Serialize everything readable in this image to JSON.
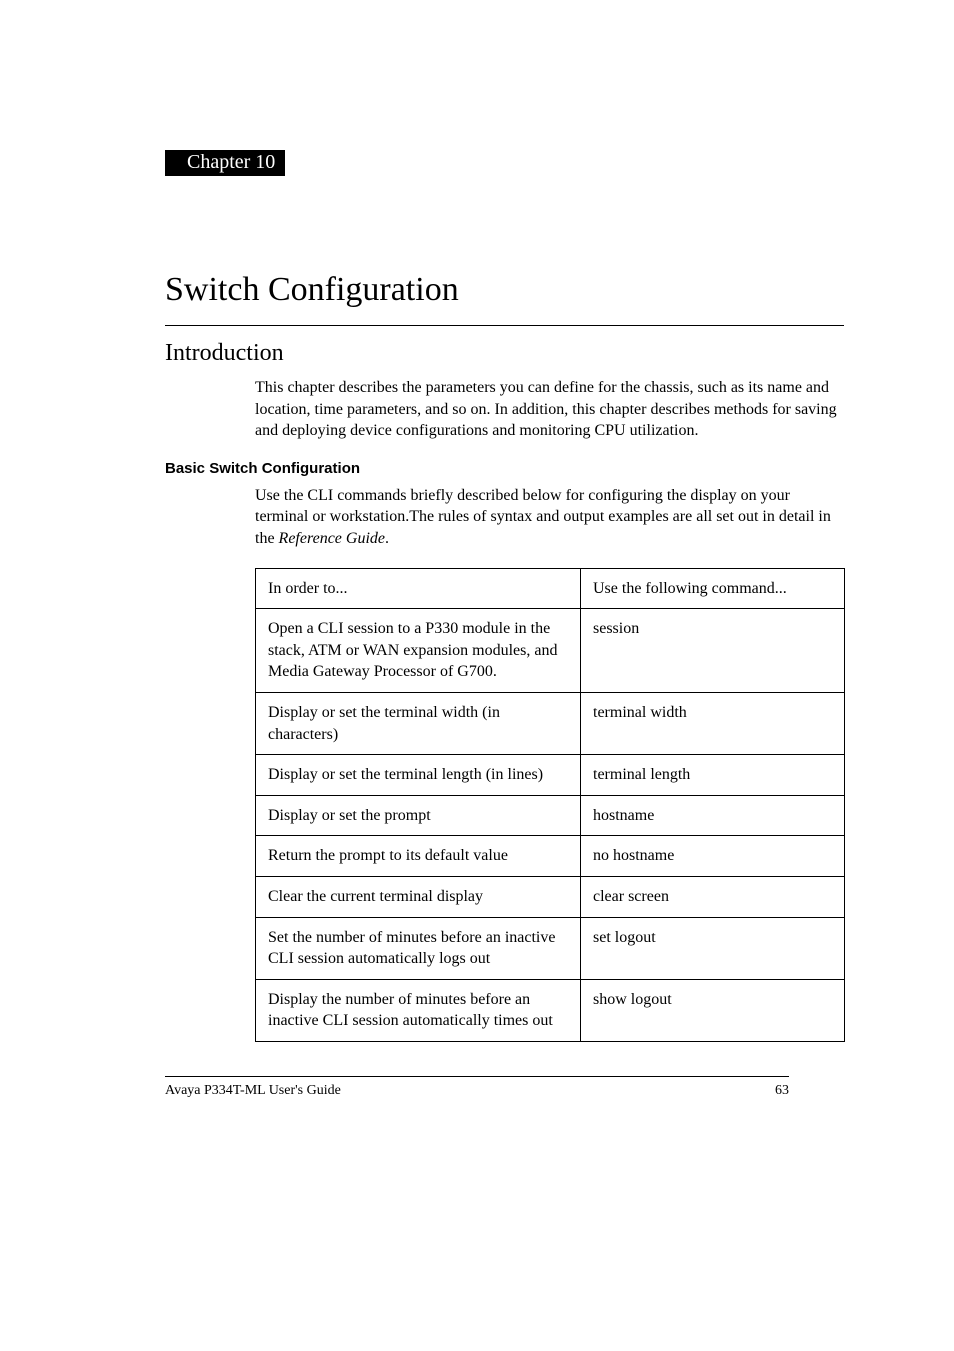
{
  "chapter": {
    "label": "Chapter 10"
  },
  "title": "Switch Configuration",
  "section": "Introduction",
  "intro_paragraph": "This chapter describes the parameters you can define for the chassis, such as its name and location, time parameters, and so on. In addition, this chapter describes methods for saving and deploying device configurations and monitoring CPU utilization.",
  "subhead": "Basic Switch Configuration",
  "sub_paragraph_pre": "Use the CLI commands briefly described below for configuring the display on your terminal or workstation.The rules of syntax and output examples are all set out in detail in the ",
  "sub_paragraph_em": "Reference Guide",
  "sub_paragraph_post": ".",
  "table": {
    "header": {
      "left": "In order to...",
      "right": "Use the following command..."
    },
    "rows": [
      {
        "left": "Open a CLI session to a P330 module in the stack, ATM or WAN expansion modules, and Media Gateway Processor of G700.",
        "right": "session"
      },
      {
        "left": "Display or set the terminal width (in characters)",
        "right": "terminal width"
      },
      {
        "left": "Display or set the terminal length (in lines)",
        "right": "terminal length"
      },
      {
        "left": "Display or set the prompt",
        "right": "hostname"
      },
      {
        "left": "Return the prompt to its default value",
        "right": "no hostname"
      },
      {
        "left": "Clear the current terminal display",
        "right": "clear screen"
      },
      {
        "left": "Set the number of minutes before an inactive CLI session automatically logs out",
        "right": "set logout"
      },
      {
        "left": "Display the number of minutes before an inactive CLI session automatically times out",
        "right": "show logout"
      }
    ]
  },
  "footer": {
    "left": "Avaya P334T-ML User's Guide",
    "right": "63"
  }
}
